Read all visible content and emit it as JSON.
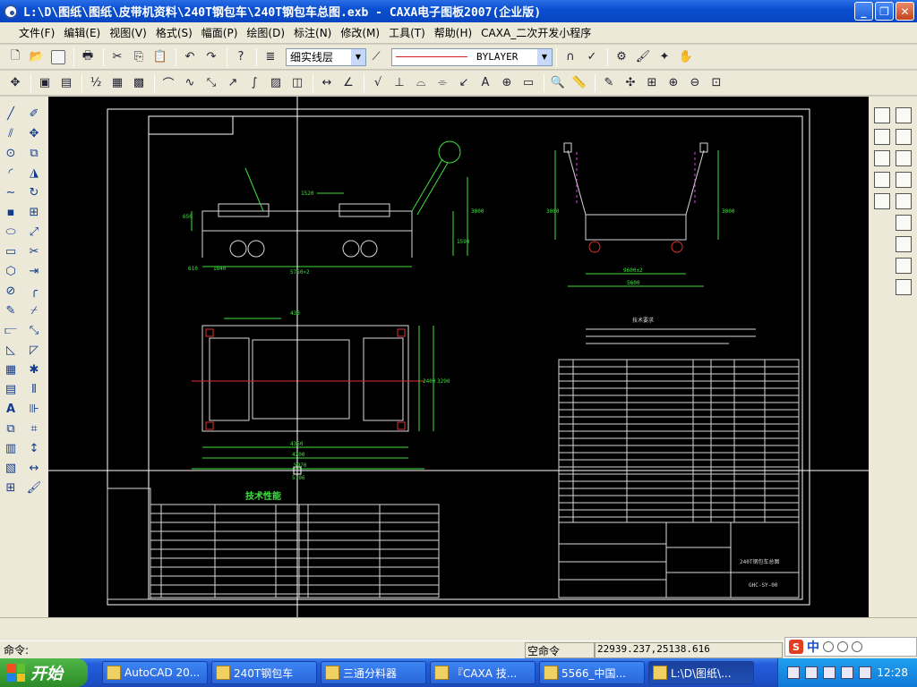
{
  "window": {
    "title": "L:\\D\\图纸\\图纸\\皮带机资料\\240T钢包车\\240T钢包车总图.exb - CAXA电子图板2007(企业版)",
    "controls": [
      "_",
      "❐",
      "✕"
    ]
  },
  "menu": {
    "items": [
      "文件(F)",
      "编辑(E)",
      "视图(V)",
      "格式(S)",
      "幅面(P)",
      "绘图(D)",
      "标注(N)",
      "修改(M)",
      "工具(T)",
      "帮助(H)",
      "CAXA_二次开发小程序"
    ]
  },
  "toolbar": {
    "layer_value": "细实线层",
    "linetype_value": "BYLAYER"
  },
  "drawing": {
    "accent": "#40e040",
    "title_block": {
      "name": "240T钢包车总图",
      "code": "GHC-SY-00"
    },
    "tech_req_title": "技术性能",
    "tech_notes_title": "技术要求",
    "dims": [
      "1520",
      "5750×2",
      "9600±2",
      "5600",
      "4350",
      "4200",
      "5970",
      "5196",
      "3000",
      "3000",
      "3000",
      "1590",
      "2400",
      "3290",
      "650",
      "430",
      "1840",
      "610"
    ]
  },
  "status": {
    "command_label": "命令:",
    "command_status": "空命令",
    "coordinates": "22939.237,25138.616"
  },
  "taskbar": {
    "start_label": "开始",
    "tasks": [
      "AutoCAD 20...",
      "240T钢包车",
      "三通分料器",
      "『CAXA 技...",
      "5566_中国...",
      "L:\\D\\图纸\\..."
    ],
    "clock": "12:28"
  },
  "ime": {
    "label": "中"
  }
}
